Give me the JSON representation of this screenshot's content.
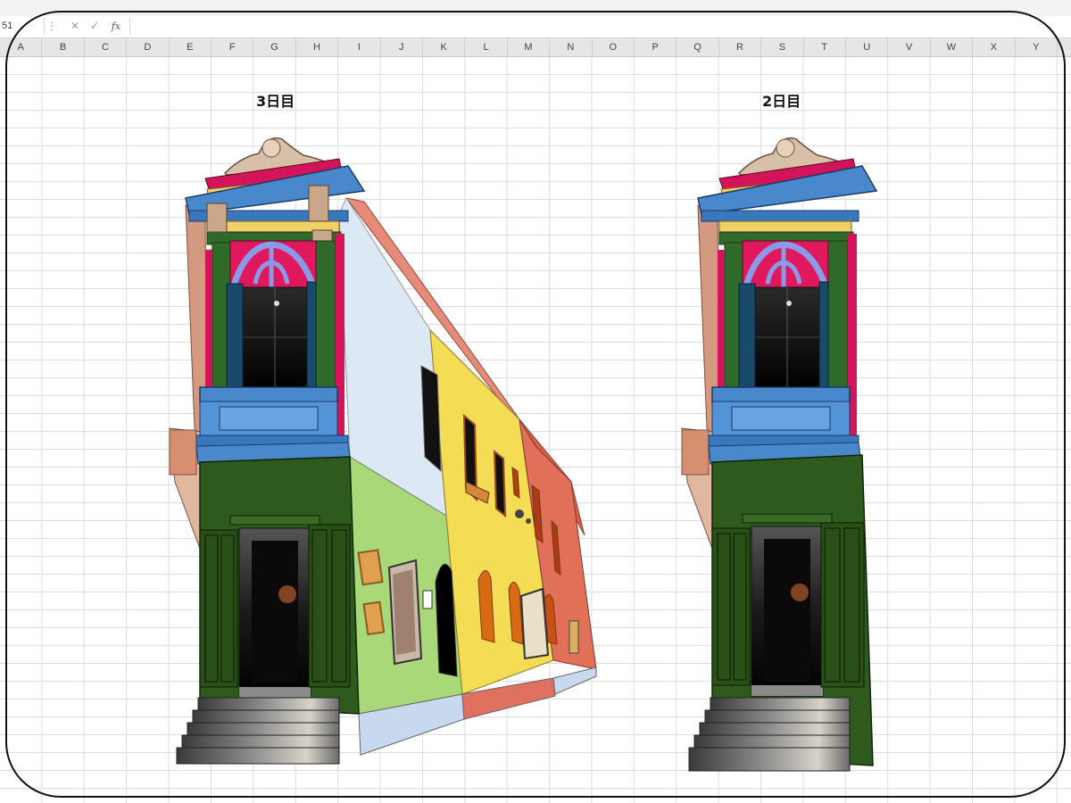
{
  "formula_bar": {
    "name_box": "51",
    "dots": "⋮",
    "cancel_icon": "✕",
    "enter_icon": "✓",
    "fx_label": "fx",
    "formula_value": ""
  },
  "columns": [
    "A",
    "B",
    "C",
    "D",
    "E",
    "F",
    "G",
    "H",
    "I",
    "J",
    "K",
    "L",
    "M",
    "N",
    "O",
    "P",
    "Q",
    "R",
    "S",
    "T",
    "U",
    "V",
    "W",
    "X",
    "Y"
  ],
  "drawings": [
    {
      "title": "3日目"
    },
    {
      "title": "2日目"
    }
  ],
  "colors": {
    "grid_line": "#dcdcdc",
    "header_bg": "#e6e6e6",
    "wall_light_blue": "#dce8f4",
    "wall_green": "#a8d878",
    "wall_yellow": "#f5dc55",
    "wall_red": "#e07058",
    "roof_red": "#e88a78",
    "facade_green": "#2f5a1e",
    "balcony_blue": "#4a88cc",
    "magenta": "#d4145a",
    "cornice_yellow": "#f2d068"
  }
}
